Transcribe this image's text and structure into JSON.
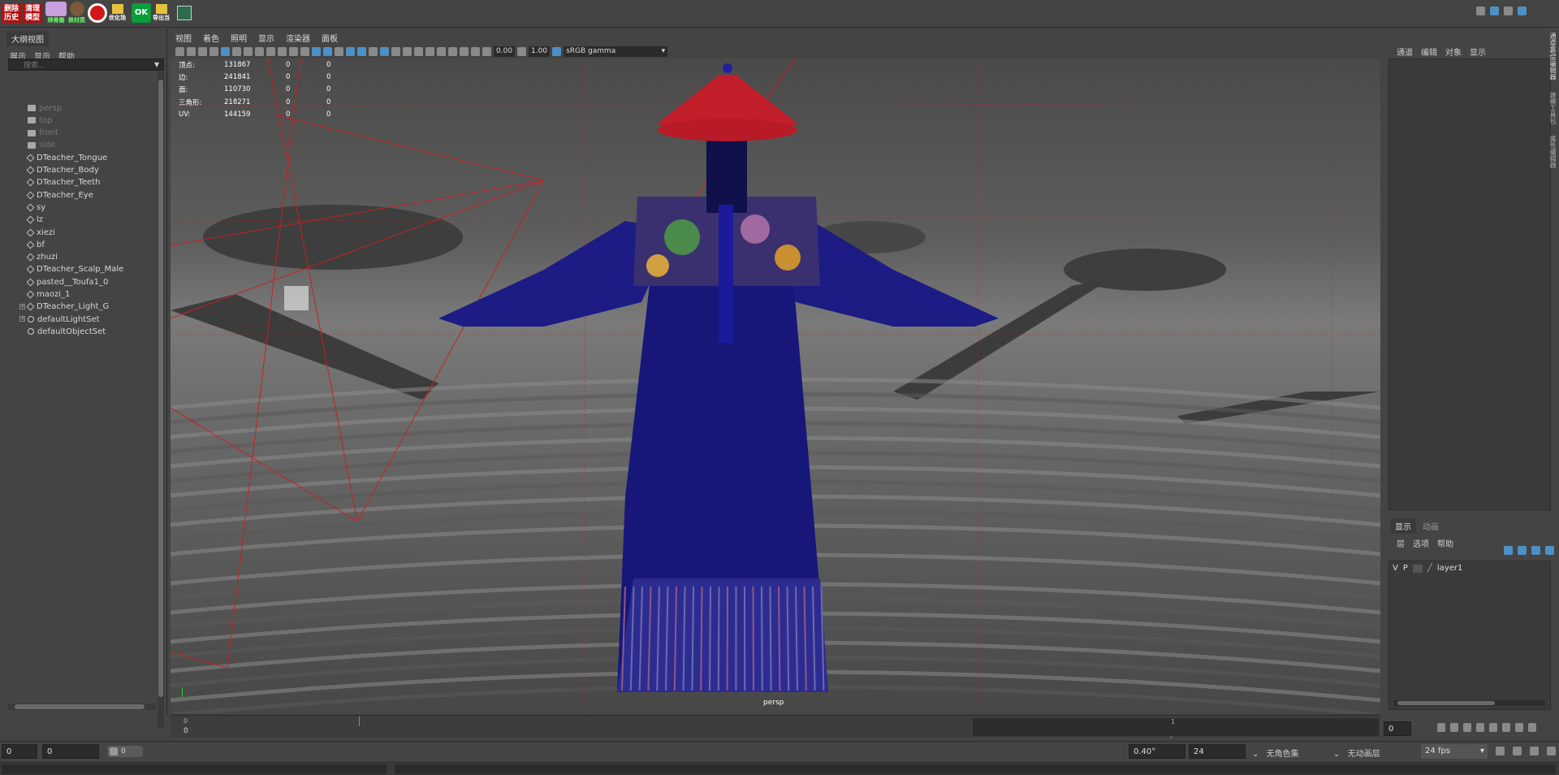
{
  "shelf": {
    "btn1": "删除\n历史",
    "btn2": "清理\n模型",
    "btn3": "绑骨骼",
    "btn4": "换材质",
    "btn5": "优化场",
    "btn6": "OK",
    "btn7": "导出当"
  },
  "outliner": {
    "title": "大纲视图",
    "menu": [
      "展示",
      "显示",
      "帮助"
    ],
    "search_placeholder": "搜索...",
    "items": [
      {
        "label": "persp",
        "type": "camera",
        "dim": true
      },
      {
        "label": "top",
        "type": "camera",
        "dim": true
      },
      {
        "label": "front",
        "type": "camera",
        "dim": true
      },
      {
        "label": "side",
        "type": "camera",
        "dim": true
      },
      {
        "label": "DTeacher_Tongue",
        "type": "mesh"
      },
      {
        "label": "DTeacher_Body",
        "type": "mesh"
      },
      {
        "label": "DTeacher_Teeth",
        "type": "mesh"
      },
      {
        "label": "DTeacher_Eye",
        "type": "mesh"
      },
      {
        "label": "sy",
        "type": "mesh"
      },
      {
        "label": "lz",
        "type": "mesh"
      },
      {
        "label": "xiezi",
        "type": "mesh"
      },
      {
        "label": "bf",
        "type": "mesh"
      },
      {
        "label": "zhuzi",
        "type": "mesh"
      },
      {
        "label": "DTeacher_Scalp_Male",
        "type": "mesh"
      },
      {
        "label": "pasted__Toufa1_0",
        "type": "mesh"
      },
      {
        "label": "maozi_1",
        "type": "mesh"
      },
      {
        "label": "DTeacher_Light_G",
        "type": "group",
        "expandable": true
      },
      {
        "label": "defaultLightSet",
        "type": "set",
        "expandable": true
      },
      {
        "label": "defaultObjectSet",
        "type": "set"
      }
    ]
  },
  "viewport": {
    "menu": [
      "视图",
      "着色",
      "照明",
      "显示",
      "渲染器",
      "面板"
    ],
    "exposure": "0.00",
    "gamma": "1.00",
    "colorspace": "sRGB gamma",
    "hud": [
      {
        "label": "顶点:",
        "value": "131867",
        "a": "0",
        "b": "0"
      },
      {
        "label": "边:",
        "value": "241841",
        "a": "0",
        "b": "0"
      },
      {
        "label": "面:",
        "value": "110730",
        "a": "0",
        "b": "0"
      },
      {
        "label": "三角形:",
        "value": "218271",
        "a": "0",
        "b": "0"
      },
      {
        "label": "UV:",
        "value": "144159",
        "a": "0",
        "b": "0"
      }
    ],
    "camera_label": "persp"
  },
  "channel_box": {
    "menu": [
      "通道",
      "编辑",
      "对象",
      "显示"
    ]
  },
  "layer_editor": {
    "tabs": [
      "显示",
      "动画"
    ],
    "menu": [
      "层",
      "选项",
      "帮助"
    ],
    "layer_v": "V",
    "layer_p": "P",
    "layer_name": "layer1"
  },
  "side_tabs": [
    "通道盒/层编辑器",
    "建模工具包",
    "属性编辑器"
  ],
  "timeline": {
    "start_tick": "0",
    "mid_tick": "1",
    "current_frame": "0"
  },
  "range": {
    "start": "0",
    "inner_start": "0",
    "slider_value": "0",
    "angle": "0.40°",
    "end": "24",
    "char_set": "无角色集",
    "anim_layer": "无动画层",
    "fps": "24 fps"
  },
  "colors": {
    "accent": "#4d90c6",
    "robe": "#1a1a7a",
    "hat_red": "#c21f2b",
    "camera_line": "#d02020"
  }
}
